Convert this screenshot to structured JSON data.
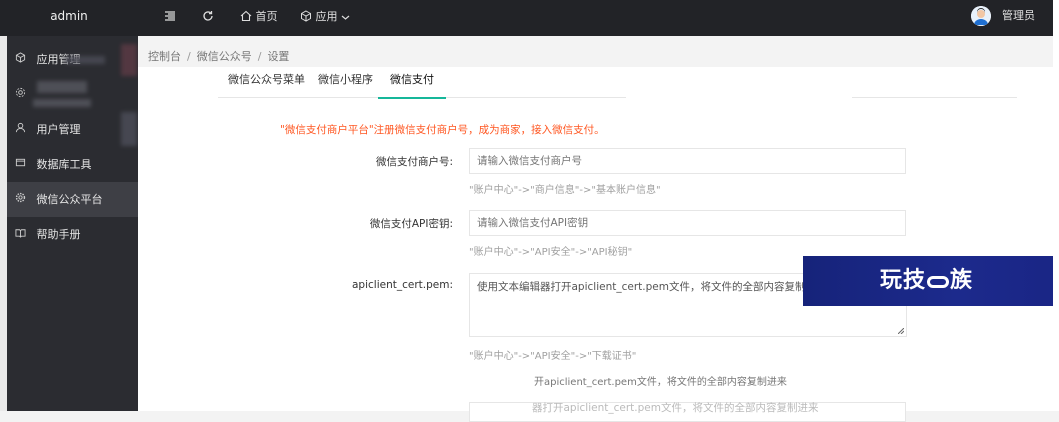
{
  "header": {
    "brand": "admin",
    "home_label": "首页",
    "app_label": "应用",
    "user_label": "管理员"
  },
  "sidebar": {
    "items": [
      {
        "label": "应用管理",
        "icon": "cube-icon"
      },
      {
        "label": "",
        "icon": "gear-icon"
      },
      {
        "label": "用户管理",
        "icon": "user-icon"
      },
      {
        "label": "数据库工具",
        "icon": "database-icon"
      },
      {
        "label": "微信公众平台",
        "icon": "settings-icon",
        "active": true
      },
      {
        "label": "帮助手册",
        "icon": "book-icon"
      }
    ]
  },
  "breadcrumb": {
    "items": [
      "控制台",
      "微信公众号",
      "设置"
    ],
    "separator": "/"
  },
  "tabs": [
    "微信公众号菜单",
    "微信小程序",
    "微信支付"
  ],
  "active_tab": "微信支付",
  "form": {
    "notice_prefix": "\"微信支付商户平台\"",
    "notice_link": "注册微信支付商户号，成为商家，接入微信支付。",
    "fields": [
      {
        "label": "微信支付商户号:",
        "placeholder": "请输入微信支付商户号",
        "hint": "\"账户中心\"->\"商户信息\"->\"基本账户信息\""
      },
      {
        "label": "微信支付API密钥:",
        "placeholder": "请输入微信支付API密钥",
        "hint": "\"账户中心\"->\"API安全\"->\"API秘钥\""
      },
      {
        "label": "apiclient_cert.pem:",
        "placeholder": "使用文本编辑器打开apiclient_cert.pem文件，将文件的全部内容复制进来",
        "hint": "\"账户中心\"->\"API安全\"->\"下载证书\""
      }
    ],
    "ghost_text_1": "开apiclient_cert.pem文件，将文件的全部内容复制进来",
    "ghost_text_2": "器打开apiclient_cert.pem文件，将文件的全部内容复制进来"
  },
  "watermark": {
    "text_before": "玩技",
    "text_after": "族"
  },
  "colors": {
    "topbar": "#222327",
    "sidebar": "#2b2c31",
    "accent": "#15b79a",
    "notice": "#ff5722",
    "watermark": "#1a237e"
  }
}
